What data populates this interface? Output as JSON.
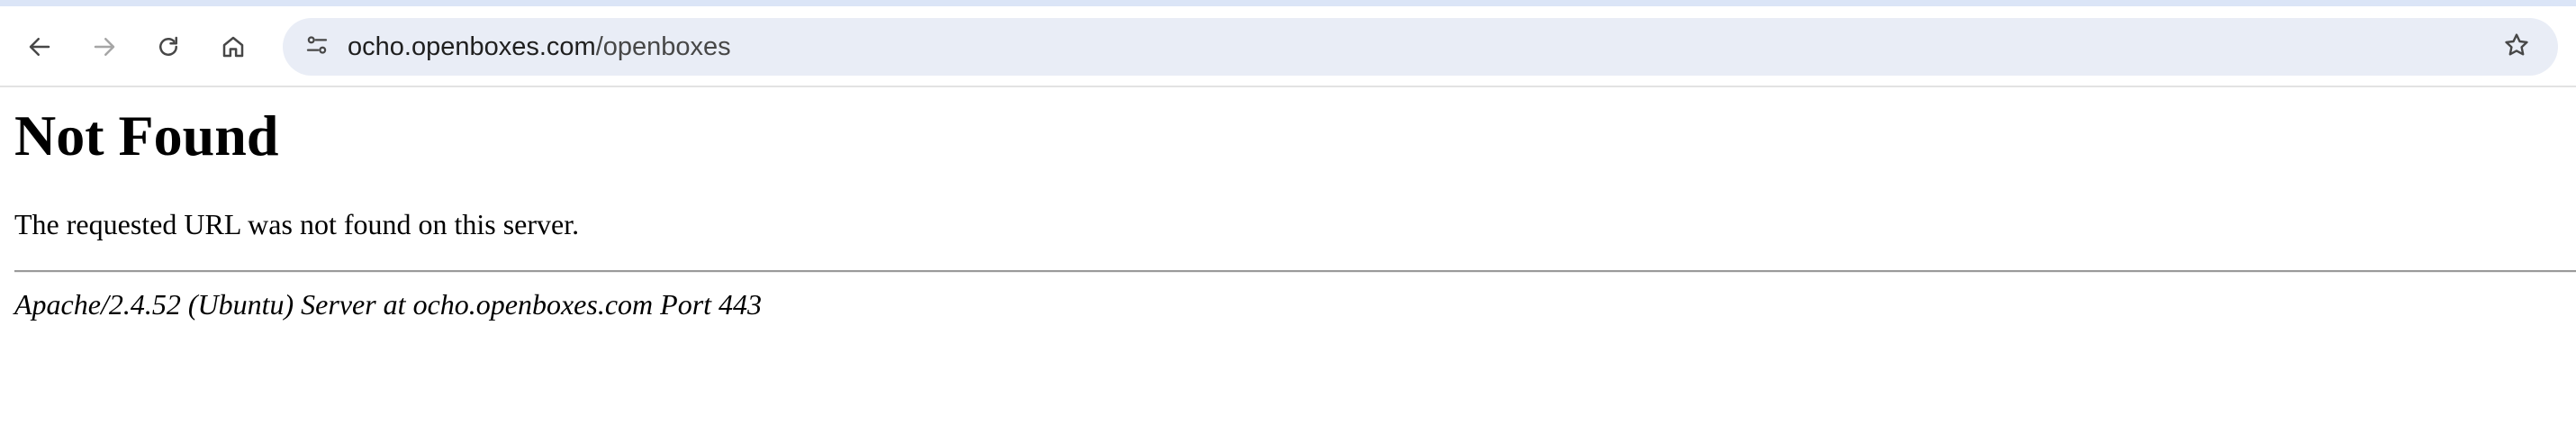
{
  "browser": {
    "nav": {
      "back_icon": "arrow-left-icon",
      "forward_icon": "arrow-right-icon",
      "reload_icon": "reload-icon",
      "home_icon": "home-icon"
    },
    "omnibox": {
      "site_info_icon": "tune-icon",
      "url_host": "ocho.openboxes.com",
      "url_path": "/openboxes",
      "bookmark_icon": "star-outline-icon"
    },
    "colors": {
      "top_strip": "#dbe5f7",
      "omnibox_bg": "#e9edf6",
      "icon": "#474747",
      "icon_disabled": "#a6a6a6"
    }
  },
  "page": {
    "heading": "Not Found",
    "message": "The requested URL was not found on this server.",
    "signature": "Apache/2.4.52 (Ubuntu) Server at ocho.openboxes.com Port 443"
  }
}
